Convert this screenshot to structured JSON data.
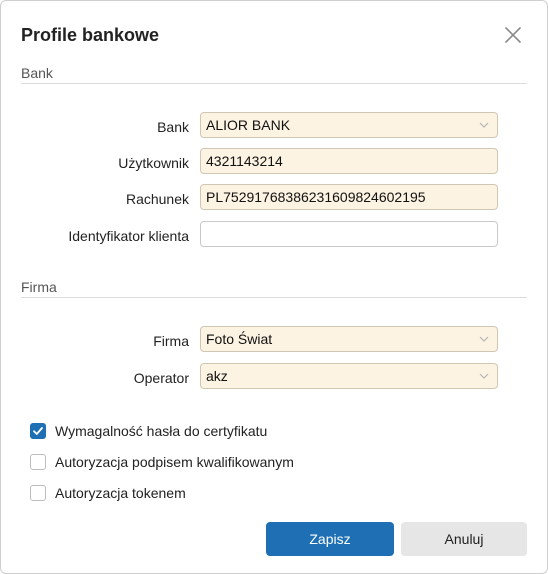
{
  "dialog": {
    "title": "Profile bankowe"
  },
  "bank_section": {
    "heading": "Bank",
    "bank_label": "Bank",
    "bank_value": "ALIOR BANK",
    "user_label": "Użytkownik",
    "user_value": "4321143214",
    "account_label": "Rachunek",
    "account_value": "PL75291768386231609824602195",
    "client_id_label": "Identyfikator klienta",
    "client_id_value": ""
  },
  "company_section": {
    "heading": "Firma",
    "company_label": "Firma",
    "company_value": "Foto Świat",
    "operator_label": "Operator",
    "operator_value": "akz"
  },
  "options": [
    {
      "label": "Wymagalność hasła do certyfikatu",
      "checked": true
    },
    {
      "label": "Autoryzacja podpisem kwalifikowanym",
      "checked": false
    },
    {
      "label": "Autoryzacja tokenem",
      "checked": false
    }
  ],
  "buttons": {
    "save": "Zapisz",
    "cancel": "Anuluj"
  },
  "colors": {
    "accent": "#1e6fb3",
    "field_background": "#fdf3e3"
  },
  "icons": {
    "close": "close-icon",
    "dropdown": "chevron-down-icon",
    "checkbox_checked": "checkmark-icon"
  }
}
